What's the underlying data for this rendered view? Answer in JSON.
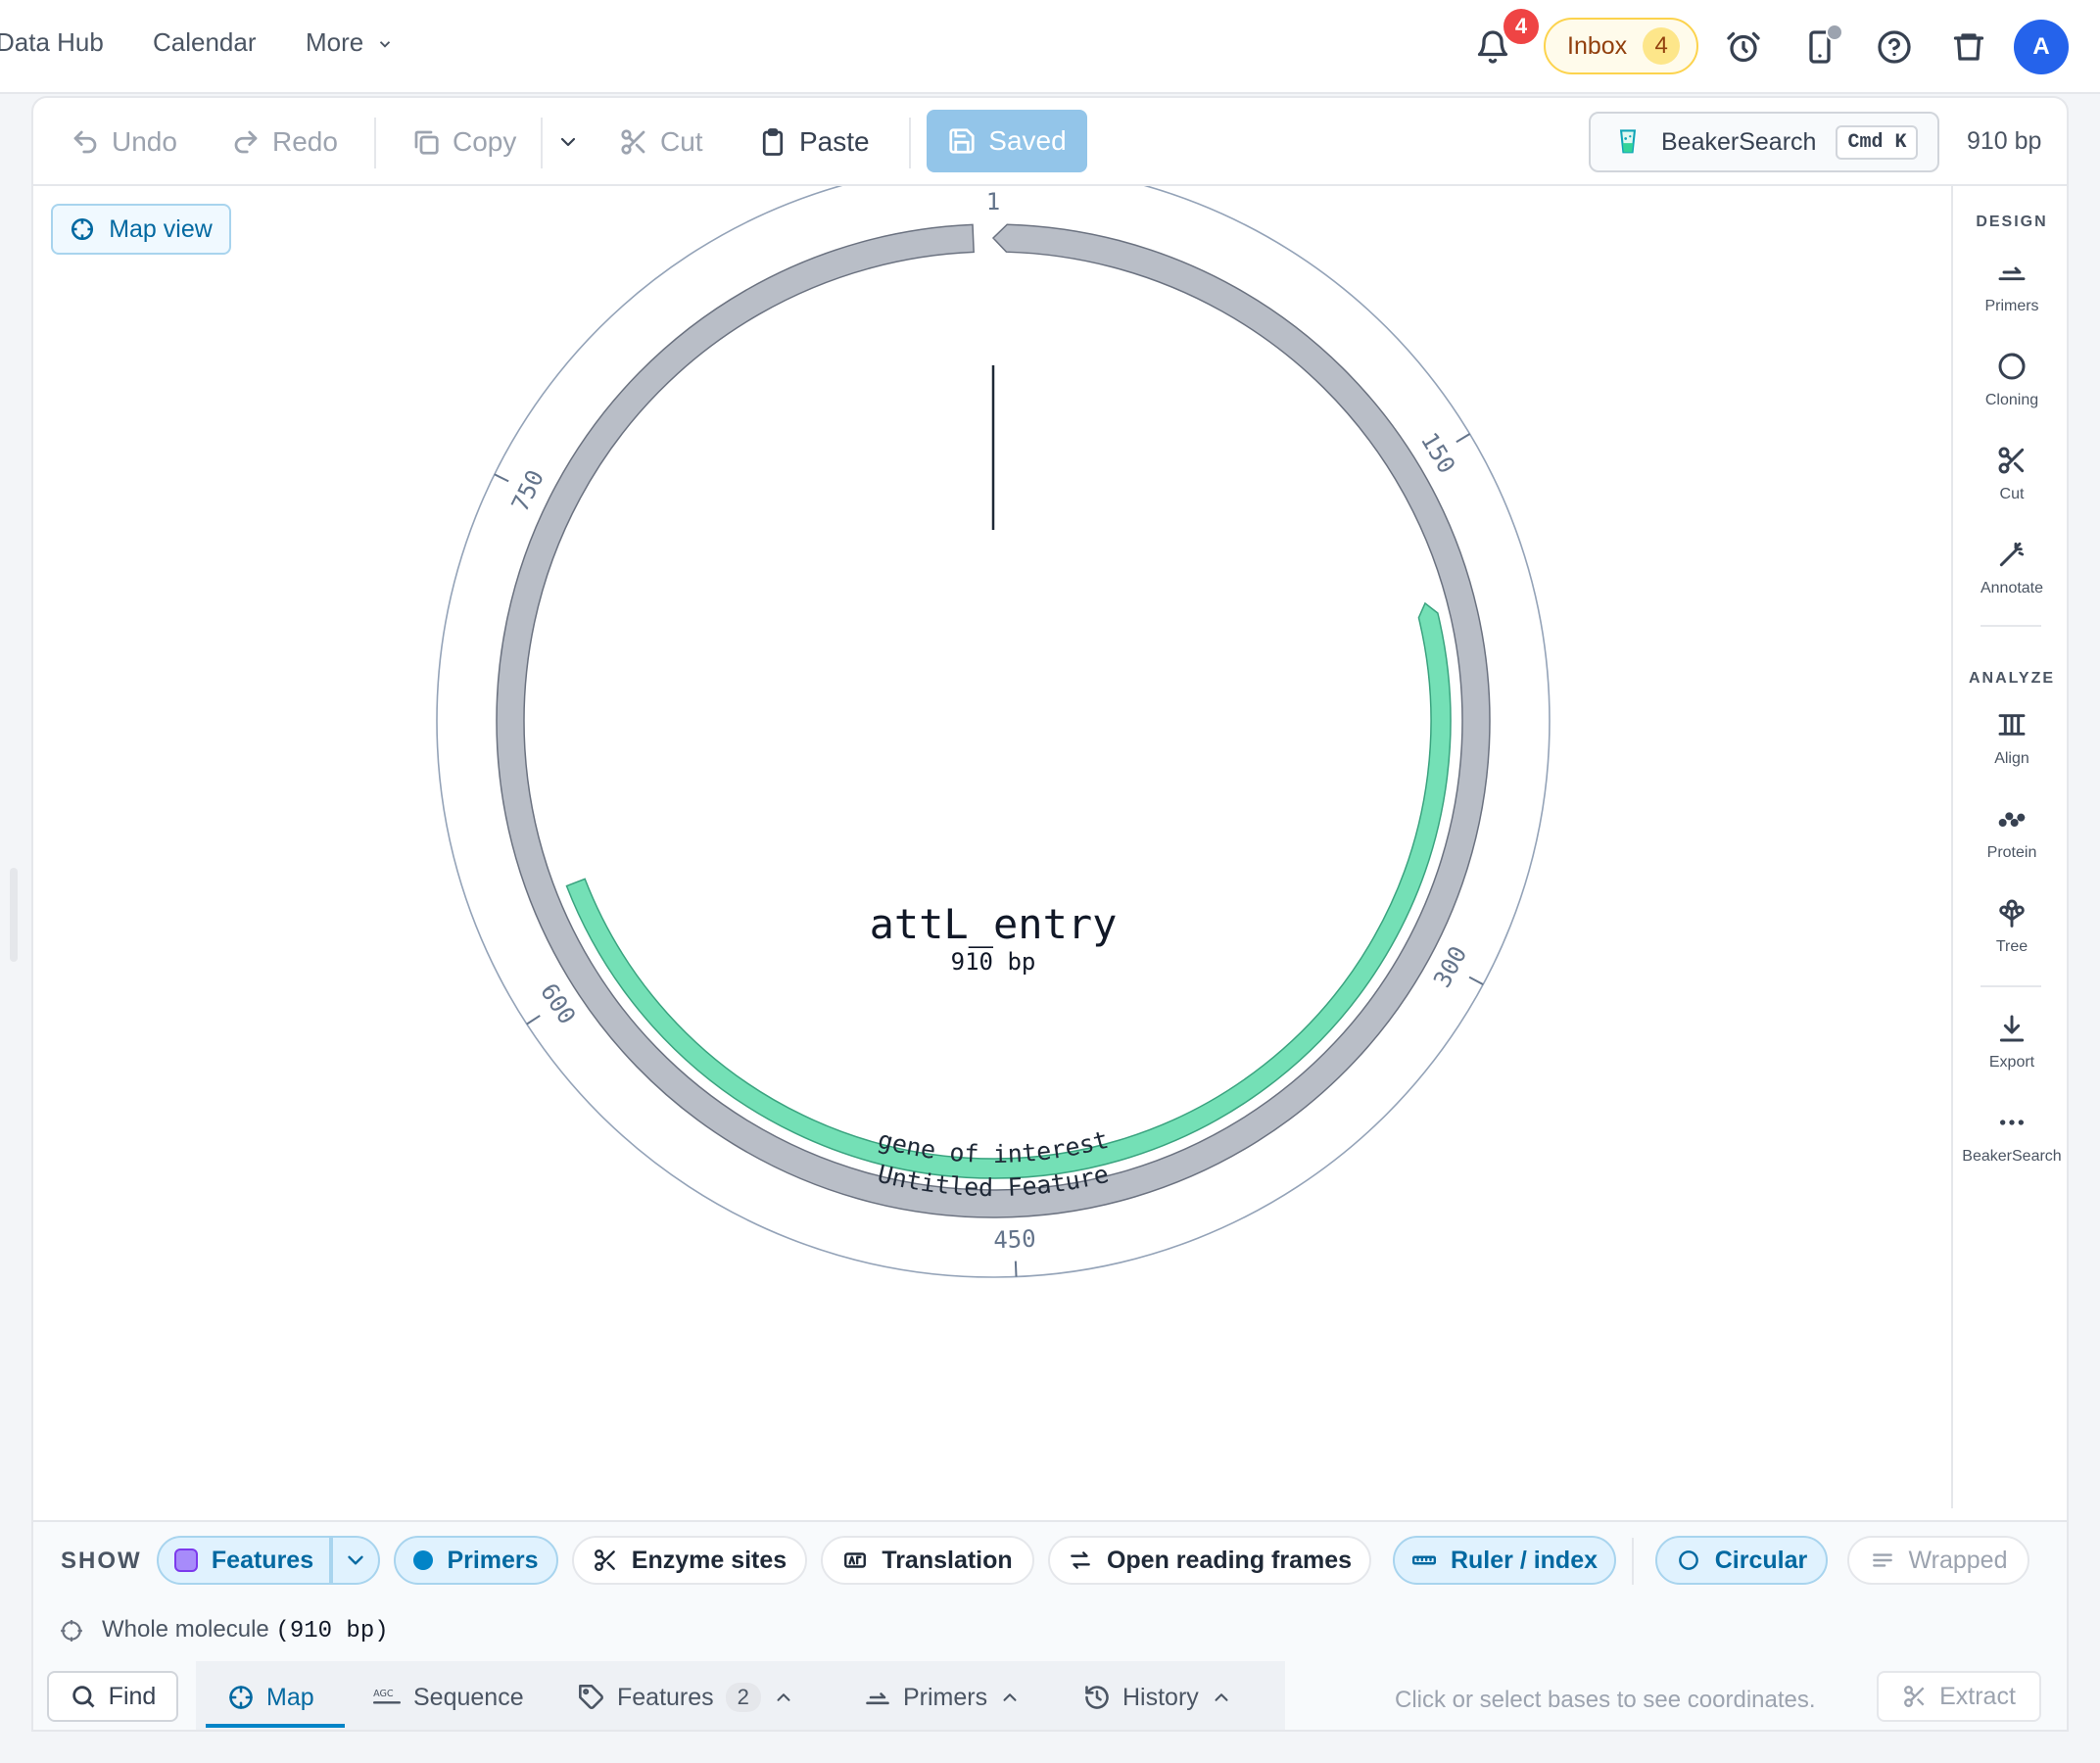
{
  "topnav": {
    "links": [
      "Data Hub",
      "Calendar",
      "More"
    ],
    "notifications_count": "4",
    "inbox_label": "Inbox",
    "inbox_count": "4",
    "avatar_initial": "A"
  },
  "toolbar": {
    "undo": "Undo",
    "redo": "Redo",
    "copy": "Copy",
    "cut": "Cut",
    "paste": "Paste",
    "saved": "Saved",
    "search_label": "BeakerSearch",
    "search_shortcut": "Cmd K",
    "length": "910 bp"
  },
  "map_view_label": "Map view",
  "plasmid": {
    "name": "attL_entry",
    "length_label": "910 bp",
    "total_bp": 910,
    "ticks": [
      1,
      150,
      300,
      450,
      600,
      750
    ],
    "features": [
      {
        "name": "Untitled Feature",
        "start": 1,
        "end": 905,
        "strand": "reverse",
        "color": "#b9bec7"
      },
      {
        "name": "gene of interest",
        "start": 190,
        "end": 630,
        "strand": "reverse",
        "color": "#74e0b6"
      }
    ]
  },
  "sidebar": {
    "design_header": "DESIGN",
    "design_items": [
      "Primers",
      "Cloning",
      "Cut",
      "Annotate"
    ],
    "analyze_header": "ANALYZE",
    "analyze_items": [
      "Align",
      "Protein",
      "Tree"
    ],
    "other_items": [
      "Export",
      "BeakerSearch"
    ]
  },
  "showbar": {
    "label": "SHOW",
    "features": "Features",
    "primers": "Primers",
    "enzyme_sites": "Enzyme sites",
    "translation": "Translation",
    "orfs": "Open reading frames",
    "ruler": "Ruler / index",
    "circular": "Circular",
    "wrapped": "Wrapped",
    "features_color": "#a78bfa",
    "primers_color": "#0284c7"
  },
  "selection": {
    "prefix": "Whole molecule",
    "range": "(910 bp)"
  },
  "bottom_tabs": {
    "find": "Find",
    "map": "Map",
    "sequence": "Sequence",
    "features": "Features",
    "features_count": "2",
    "primers": "Primers",
    "history": "History",
    "coords_hint": "Click or select bases to see coordinates.",
    "extract": "Extract"
  }
}
